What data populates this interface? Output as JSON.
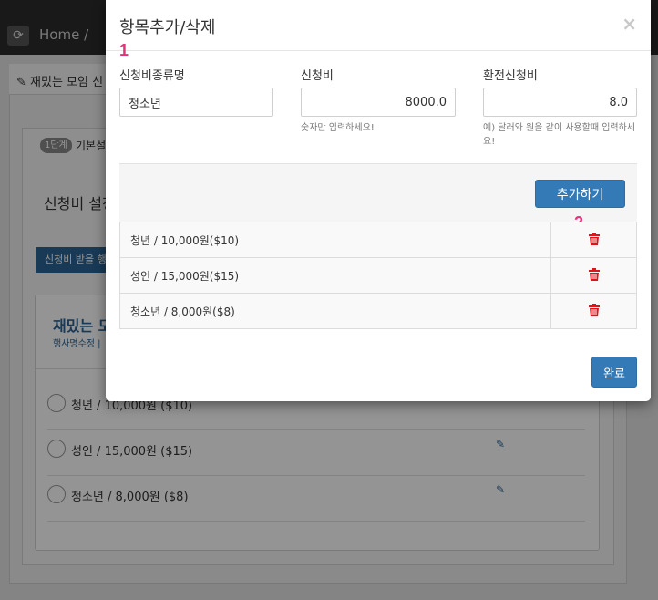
{
  "background": {
    "nav": {
      "refresh_icon": "refresh-icon",
      "home_label": "Home /"
    },
    "panel_title": "재밌는 모임 신",
    "step": {
      "badge": "1단계",
      "label": "기본설"
    },
    "fee_setting_title": "신청비 설정",
    "collect_button": "신청비 받을 행사",
    "event": {
      "title": "재밌는 모",
      "edit_link": "행사명수정 |"
    },
    "options": [
      {
        "label": "청년 / 10,000원 ($10)"
      },
      {
        "label": "성인 / 15,000원 ($15)"
      },
      {
        "label": "청소년 / 8,000원 ($8)"
      }
    ]
  },
  "modal": {
    "title": "항목추가/삭제",
    "close": "×",
    "markers": {
      "one": "1",
      "two": "2"
    },
    "fields": {
      "name": {
        "label": "신청비종류명",
        "value": "청소년"
      },
      "fee": {
        "label": "신청비",
        "value": "8000.0",
        "help": "숫자만 입력하세요!"
      },
      "exchange": {
        "label": "환전신청비",
        "value": "8.0",
        "help": "예) 달러와 원을 같이 사용할때 입력하세요!"
      }
    },
    "add_button": "추가하기",
    "items": [
      {
        "name": "청년 / 10,000원($10)"
      },
      {
        "name": "성인 / 15,000원($15)"
      },
      {
        "name": "청소년 / 8,000원($8)"
      }
    ],
    "done_button": "완료",
    "colors": {
      "primary": "#337ab7",
      "delete": "#d9161b",
      "marker": "#e0347a"
    }
  }
}
